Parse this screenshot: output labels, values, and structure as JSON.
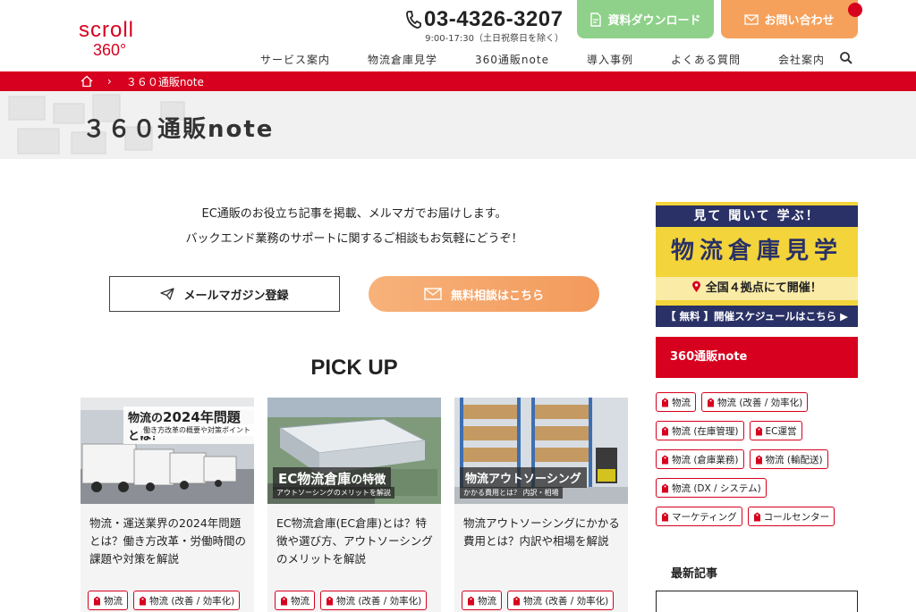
{
  "header": {
    "logo_text": "scroll",
    "logo_sub": "360°",
    "phone": "03-4326-3207",
    "hours": "9:00-17:30（土日祝祭日を除く）",
    "download_label": "資料ダウンロード",
    "contact_label": "お問い合わせ"
  },
  "nav": {
    "items": [
      "サービス案内",
      "物流倉庫見学",
      "360通販note",
      "導入事例",
      "よくある質問",
      "会社案内"
    ]
  },
  "breadcrumb": {
    "sep": "›",
    "current": "３６０通販note"
  },
  "page": {
    "title": "３６０通販note"
  },
  "intro": {
    "line1": "EC通販のお役立ち記事を掲載、メルマガでお届けします。",
    "line2": "バックエンド業務のサポートに関するご相談もお気軽にどうぞ！",
    "mail_button": "メールマガジン登録",
    "consult_button": "無料相談はこちら"
  },
  "pickup": {
    "title": "PICK UP",
    "cards": [
      {
        "img_label_pre": "物流の",
        "img_label_main": "2024年問題",
        "img_label_post": "とは？",
        "img_sub": "働き方改革の概要や対策ポイント",
        "title": "物流・運送業界の2024年問題とは？働き方改革・労働時間の課題や対策を解説",
        "tags": [
          "物流",
          "物流 (改善 / 効率化)"
        ]
      },
      {
        "img_label_main": "EC物流倉庫",
        "img_label_post": "の特徴",
        "img_sub": "アウトソーシングのメリットを解説",
        "title": "EC物流倉庫(EC倉庫)とは？特徴や選び方、アウトソーシングのメリットを解説",
        "tags": [
          "物流",
          "物流 (改善 / 効率化)"
        ]
      },
      {
        "img_label_main": "物流アウトソーシング",
        "img_sub": "かかる費用とは？ 内訳・相場",
        "title": "物流アウトソーシングにかかる費用とは？内訳や相場を解説",
        "tags": [
          "物流",
          "物流 (改善 / 効率化)"
        ]
      }
    ]
  },
  "sidebar": {
    "banner": {
      "top": "見て 聞いて 学ぶ！",
      "main": "物流倉庫見学",
      "location": "全国４拠点にて開催！",
      "bottom": "【 無料 】開催スケジュールはこちら ▶"
    },
    "section_title": "360通販note",
    "tags": [
      "物流",
      "物流 (改善 / 効率化)",
      "物流 (在庫管理)",
      "EC運営",
      "物流 (倉庫業務)",
      "物流 (輸配送)",
      "物流 (DX / システム)",
      "マーケティング",
      "コールセンター"
    ],
    "latest_title": "最新記事"
  },
  "colors": {
    "brand_red": "#d7001e",
    "download_green": "#8fd18a",
    "contact_orange": "#f5a15b",
    "banner_navy": "#2a3166",
    "banner_yellow": "#f3d43a"
  }
}
